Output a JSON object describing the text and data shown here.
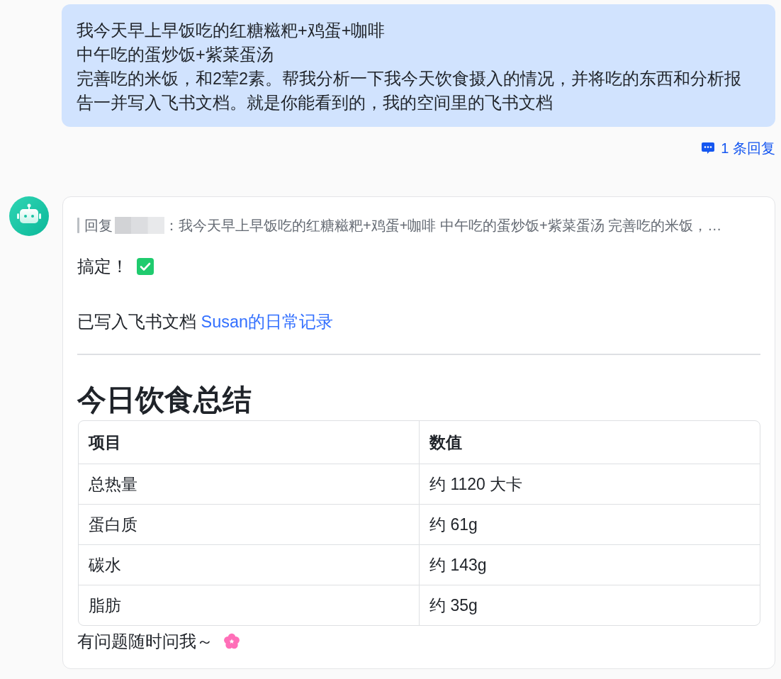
{
  "user_message": {
    "lines": [
      "我今天早上早饭吃的红糖糍粑+鸡蛋+咖啡",
      "中午吃的蛋炒饭+紫菜蛋汤",
      "完善吃的米饭，和2荤2素。帮我分析一下我今天饮食摄入的情况，并将吃的东西和分析报告一并写入飞书文档。就是你能看到的，我的空间里的飞书文档"
    ]
  },
  "reply_count": "1 条回复",
  "bot_message": {
    "quote": {
      "label": "回复",
      "text": "：我今天早上早饭吃的红糖糍粑+鸡蛋+咖啡 中午吃的蛋炒饭+紫菜蛋汤 完善吃的米饭，…"
    },
    "status": "搞定！",
    "doc_line": {
      "text": "已写入飞书文档 ",
      "link": "Susan的日常记录"
    },
    "heading": "今日饮食总结",
    "table": {
      "columns": [
        "项目",
        "数值"
      ],
      "rows": [
        [
          "总热量",
          "约 1120 大卡"
        ],
        [
          "蛋白质",
          "约 61g"
        ],
        [
          "碳水",
          "约 143g"
        ],
        [
          "脂肪",
          "约 35g"
        ]
      ]
    },
    "closing": "有问题随时问我～"
  }
}
